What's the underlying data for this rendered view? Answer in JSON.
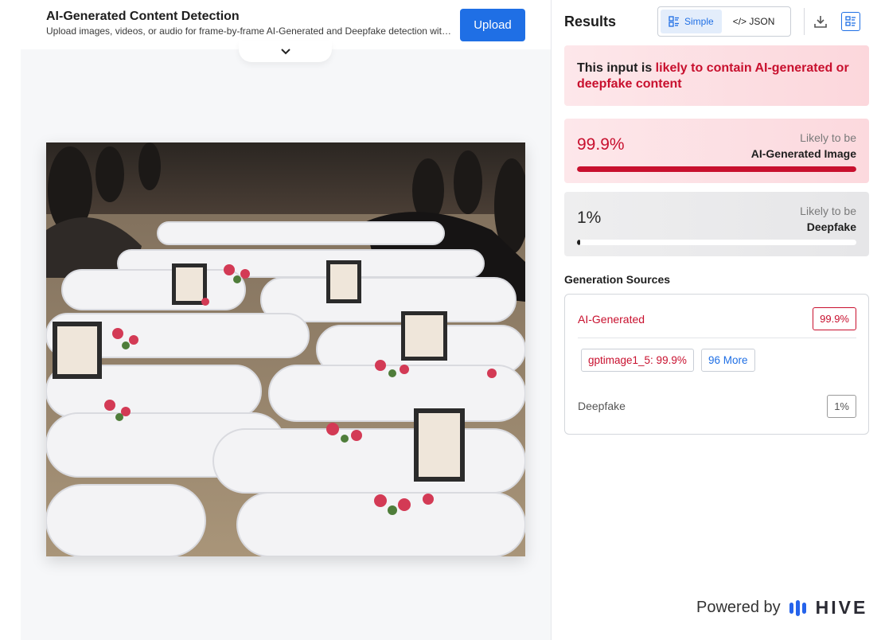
{
  "header": {
    "title": "AI-Generated Content Detection",
    "subtitle": "Upload images, videos, or audio for frame-by-frame AI-Generated and Deepfake detection with...",
    "upload_label": "Upload"
  },
  "results": {
    "title": "Results",
    "toggle": {
      "simple_label": "Simple",
      "json_label": "</> JSON",
      "active": "simple"
    },
    "alert": {
      "prefix": "This input is ",
      "highlight": "likely to contain AI-generated or deepfake content"
    },
    "scores": [
      {
        "percent_text": "99.9%",
        "likely_line1": "Likely to be",
        "likely_line2": "AI-Generated Image",
        "fraction": 0.999,
        "color": "#c8102e"
      },
      {
        "percent_text": "1%",
        "likely_line1": "Likely to be",
        "likely_line2": "Deepfake",
        "fraction": 0.01,
        "color": "#1e1e1e"
      }
    ],
    "generation_sources": {
      "title": "Generation Sources",
      "ai_label": "AI-Generated",
      "ai_value": "99.9%",
      "model_chip": "gptimage1_5: 99.9%",
      "more_chip": "96 More",
      "deepfake_label": "Deepfake",
      "deepfake_value": "1%"
    }
  },
  "footer": {
    "powered_by": "Powered by",
    "brand": "HIVE"
  },
  "colors": {
    "accent": "#1f6fe5",
    "alert_red": "#c8102e"
  },
  "icons": [
    "chevron-down-icon",
    "list-icon",
    "download-icon",
    "detail-view-icon",
    "hive-logo-icon"
  ]
}
